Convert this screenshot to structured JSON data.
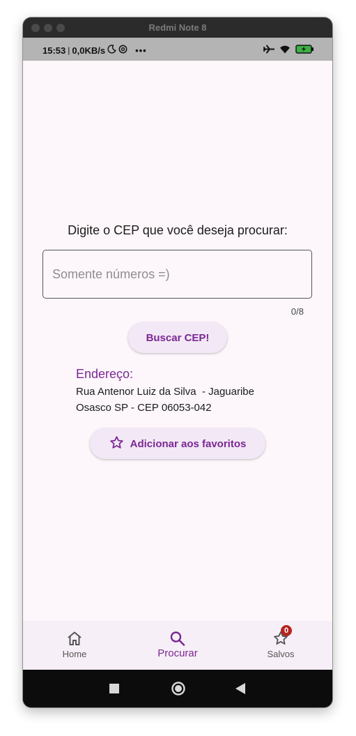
{
  "window": {
    "title": "Redmi Note 8"
  },
  "statusbar": {
    "time": "15:53",
    "separator": "|",
    "net_speed": "0,0KB/s",
    "more": "•••"
  },
  "main": {
    "prompt": "Digite o CEP que você deseja procurar:",
    "input_placeholder": "Somente números =)",
    "input_value": "",
    "counter": "0/8",
    "search_button": "Buscar CEP!",
    "address_heading": "Endereço:",
    "address_line1": "Rua Antenor Luiz da Silva  - Jaguaribe",
    "address_line2": "Osasco SP - CEP 06053-042",
    "favorite_button": "Adicionar aos favoritos"
  },
  "bottom_nav": {
    "items": [
      {
        "label": "Home",
        "icon": "home-icon"
      },
      {
        "label": "Procurar",
        "icon": "search-icon",
        "active": true
      },
      {
        "label": "Salvos",
        "icon": "star-icon",
        "badge": "0"
      }
    ]
  },
  "colors": {
    "accent": "#7a2793",
    "background": "#fdf7fb",
    "button_bg": "#f3e8f6",
    "badge": "#b3261e"
  }
}
